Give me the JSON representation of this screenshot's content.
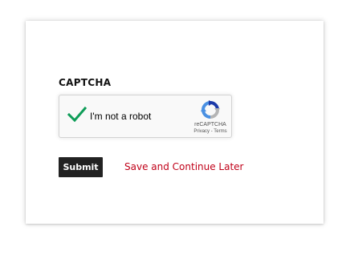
{
  "form": {
    "captcha_heading": "CAPTCHA",
    "submit_label": "Submit",
    "save_later_label": "Save and Continue Later"
  },
  "recaptcha": {
    "checkbox_label": "I'm not a robot",
    "checked": true,
    "brand": "reCAPTCHA",
    "privacy_label": "Privacy",
    "separator": " - ",
    "terms_label": "Terms",
    "check_icon": "green-checkmark-icon",
    "logo_icon": "recaptcha-logo-icon"
  },
  "colors": {
    "check_green": "#0f9d58",
    "submit_background": "#222222",
    "link_red": "#c00018",
    "recaptcha_blue": "#4a90e2",
    "recaptcha_gray": "#b5b5b5"
  }
}
